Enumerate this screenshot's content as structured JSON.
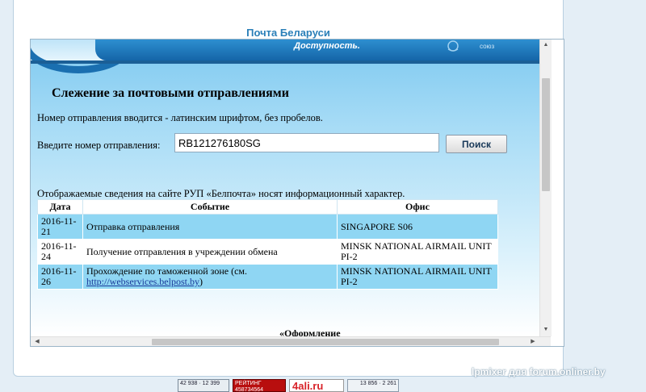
{
  "frame": {
    "title": "Почта Беларуси"
  },
  "banner": {
    "slogan": "Доступность.",
    "emblem_label": "союз"
  },
  "page": {
    "title": "Слежение за почтовыми отправлениями",
    "hint": "Номер отправления вводится - латинским шрифтом, без пробелов.",
    "input_label": "Введите номер отправления:",
    "tracking_number": "RB121276180SG",
    "search_label": "Поиск",
    "disclaimer": "Отображаемые сведения на сайте РУП «Белпочта» носят информационный характер.",
    "section_heading": "«Оформление"
  },
  "table": {
    "headers": [
      "Дата",
      "Событие",
      "Офис"
    ],
    "rows": [
      {
        "date": "2016-11-21",
        "event": "Отправка отправления",
        "office": "SINGAPORE S06"
      },
      {
        "date": "2016-11-24",
        "event": "Получение отправления в учреждении обмена",
        "office": "MINSK NATIONAL AIRMAIL UNIT PI-2"
      },
      {
        "date": "2016-11-26",
        "event": "Прохождение по таможенной зоне (см.",
        "event_link": "http://webservices.belpost.by",
        "event_suffix": ")",
        "office": "MINSK NATIONAL AIRMAIL UNIT PI-2"
      }
    ]
  },
  "footer": {
    "badge1": "42 938 · 12 399",
    "badge2": "РЕЙТИНГ 458734564",
    "badge3": "4ali.ru",
    "badge4": "13 856 · 2 261"
  },
  "watermark": "lpmixer для forum.onliner.by",
  "colors": {
    "accent": "#2a7fb8",
    "row_highlight": "#8fd6f3",
    "banner_blue": "#1565a8"
  },
  "icons": {
    "scroll_up": "arrow-up-icon",
    "scroll_down": "arrow-down-icon",
    "scroll_left": "arrow-left-icon",
    "scroll_right": "arrow-right-icon"
  }
}
